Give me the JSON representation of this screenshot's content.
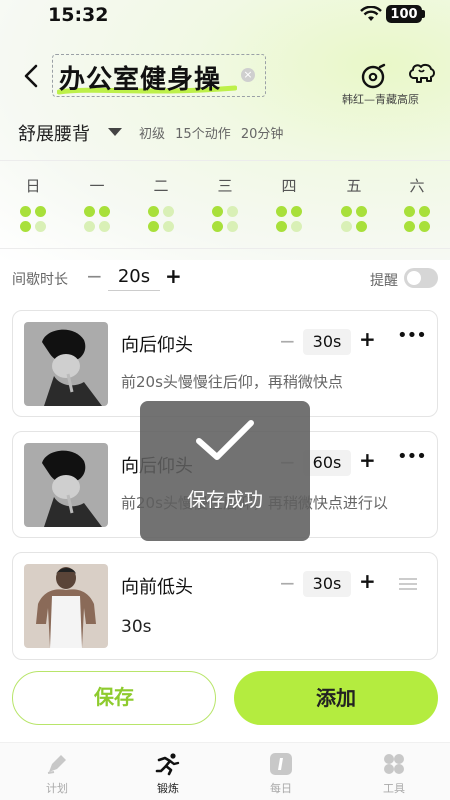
{
  "status": {
    "time": "15:32",
    "battery": "100"
  },
  "header": {
    "title": "办公室健身操",
    "music_caption": "韩红—青藏高原"
  },
  "plan": {
    "name": "舒展腰背",
    "level": "初级",
    "count": "15个动作",
    "duration": "20分钟"
  },
  "week": {
    "days": [
      "日",
      "一",
      "二",
      "三",
      "四",
      "五",
      "六"
    ]
  },
  "rest": {
    "label": "间歇时长",
    "minus": "−",
    "value": "20s",
    "plus": "+",
    "remind_label": "提醒",
    "remind_on": false
  },
  "exercises": [
    {
      "name": "向后仰头",
      "duration": "30s",
      "desc": "前20s头慢慢往后仰，再稍微快点",
      "action": "more"
    },
    {
      "name": "向后仰头",
      "duration": "60s",
      "desc": "前20s头慢慢往后仰，再稍微快点进行以",
      "action": "more"
    },
    {
      "name": "向前低头",
      "duration": "30s",
      "desc": "30s",
      "action": "drag"
    }
  ],
  "toast": {
    "text": "保存成功"
  },
  "buttons": {
    "save": "保存",
    "add": "添加"
  },
  "tabs": [
    {
      "label": "计划",
      "icon": "pen-icon",
      "active": false
    },
    {
      "label": "锻炼",
      "icon": "run-icon",
      "active": true
    },
    {
      "label": "每日",
      "icon": "daily-icon",
      "active": false
    },
    {
      "label": "工具",
      "icon": "tools-icon",
      "active": false
    }
  ],
  "colors": {
    "accent": "#b4ec3f",
    "accent_text": "#8ecb2e"
  }
}
